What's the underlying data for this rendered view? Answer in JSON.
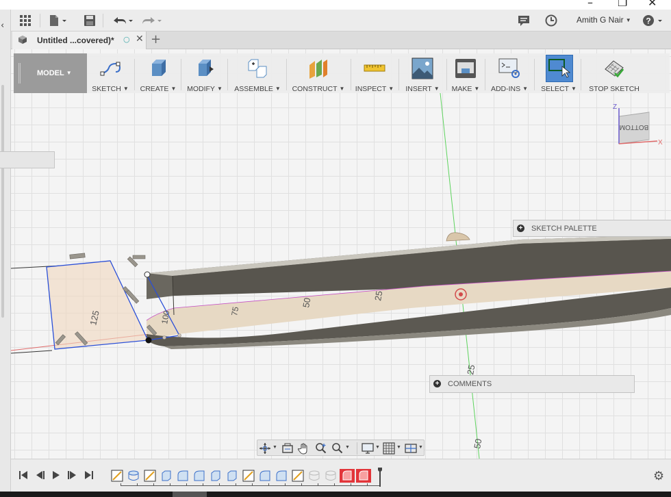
{
  "app": {
    "user_name": "Amith G Nair",
    "help_label": "?"
  },
  "document": {
    "tab_title": "Untitled ...covered)*"
  },
  "ribbon": {
    "mode": "MODEL",
    "groups": [
      {
        "label": "SKETCH",
        "icon": "sketch-icon"
      },
      {
        "label": "CREATE",
        "icon": "create-icon"
      },
      {
        "label": "MODIFY",
        "icon": "modify-icon"
      },
      {
        "label": "ASSEMBLE",
        "icon": "assemble-icon"
      },
      {
        "label": "CONSTRUCT",
        "icon": "construct-icon"
      },
      {
        "label": "INSPECT",
        "icon": "inspect-icon"
      },
      {
        "label": "INSERT",
        "icon": "insert-icon"
      },
      {
        "label": "MAKE",
        "icon": "make-icon"
      },
      {
        "label": "ADD-INS",
        "icon": "add-ins-icon"
      },
      {
        "label": "SELECT",
        "icon": "select-icon"
      }
    ],
    "stop_sketch": "STOP SKETCH"
  },
  "view_cube": {
    "face": "BOTTOM",
    "axis_z": "Z",
    "axis_x": "X"
  },
  "panels": {
    "sketch_palette": "SKETCH PALETTE",
    "comments": "COMMENTS"
  },
  "dimensions": {
    "width_125": "125",
    "depth_100": "100",
    "dim_75": "75",
    "dim_50": "50",
    "dim_25": "25",
    "axis_25": "25",
    "axis_50": "50"
  },
  "colors": {
    "accent": "#5b8fc4",
    "sketch_blue": "#2a4fd8",
    "timeline_red": "#e2353a",
    "grid": "#e0e0e0"
  }
}
